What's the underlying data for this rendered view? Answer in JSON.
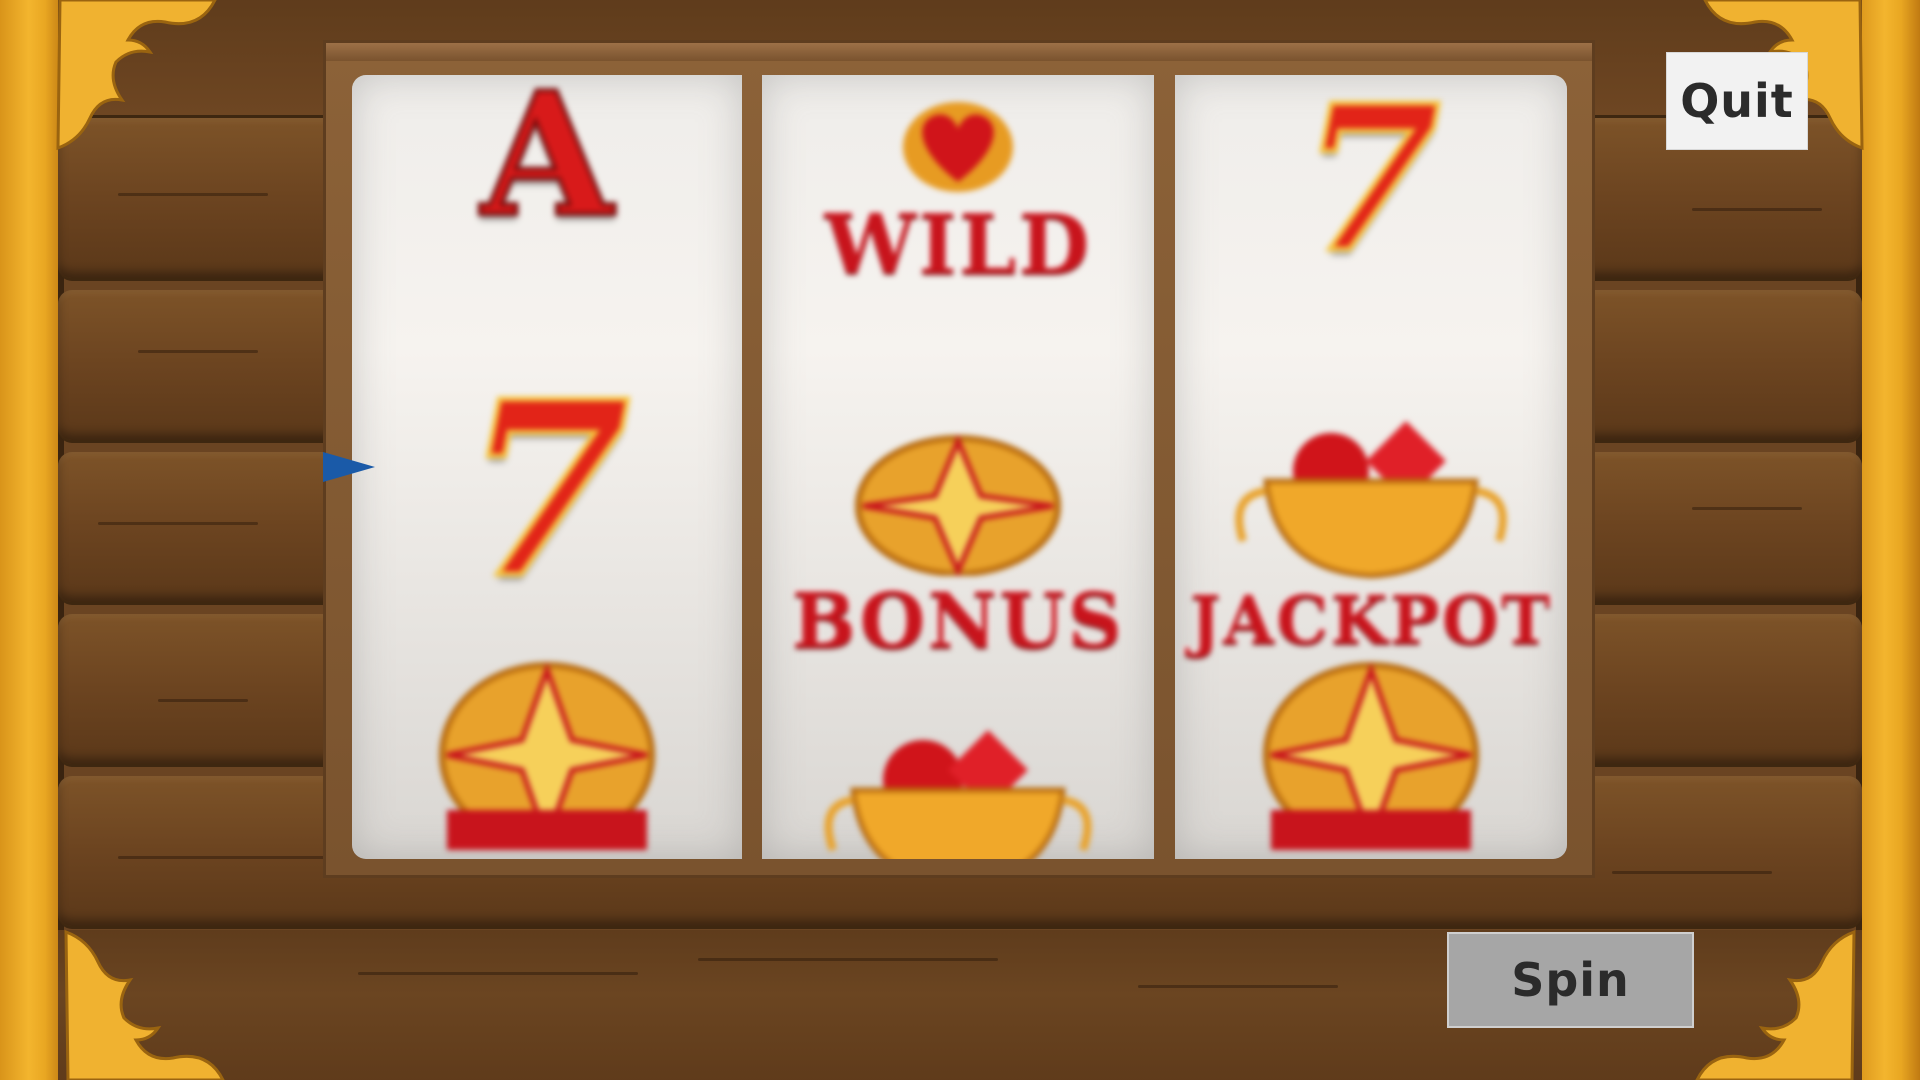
{
  "buttons": {
    "quit_label": "Quit",
    "spin_label": "Spin"
  },
  "reels": [
    {
      "symbols": [
        "A",
        "7",
        "star-bonus"
      ]
    },
    {
      "symbols": [
        "WILD",
        "BONUS",
        "gems-cup"
      ]
    },
    {
      "symbols": [
        "7",
        "JACKPOT",
        "star-bonus"
      ]
    }
  ],
  "symbol_text": {
    "ace": "A",
    "seven": "7",
    "wild": "WILD",
    "bonus": "BONUS",
    "jackpot": "JACKPOT"
  },
  "colors": {
    "wood": "#6a4422",
    "gold": "#f3b52e",
    "pointer": "#1a5aa8",
    "symbol_red": "#d81a1a"
  }
}
